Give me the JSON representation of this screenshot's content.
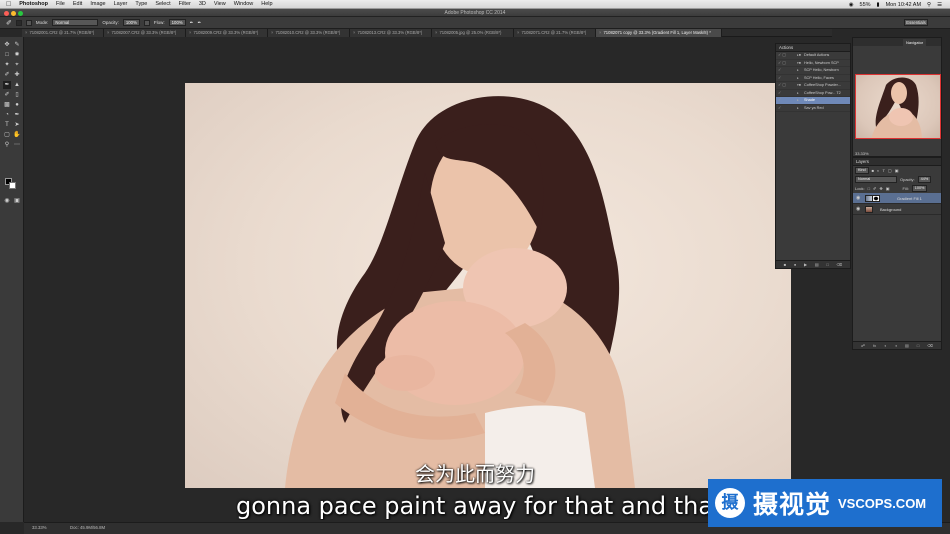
{
  "menubar": {
    "app_name": "Photoshop",
    "items": [
      "File",
      "Edit",
      "Image",
      "Layer",
      "Type",
      "Select",
      "Filter",
      "3D",
      "View",
      "Window",
      "Help"
    ],
    "battery": "55%",
    "clock": "Mon 10:42 AM"
  },
  "window": {
    "title": "Adobe Photoshop CC 2014"
  },
  "options_bar": {
    "mode_label": "Mode:",
    "mode_value": "Normal",
    "opacity_label": "Opacity:",
    "opacity_value": "100%",
    "flow_label": "Flow:",
    "flow_value": "100%",
    "workspace": "Essentials"
  },
  "tabs": [
    {
      "label": "71082001.CR2 @ 21.7% (RGB/8*)"
    },
    {
      "label": "71082007.CR2 @ 33.3% (RGB/8*)"
    },
    {
      "label": "71082009.CR2 @ 33.3% (RGB/8*)"
    },
    {
      "label": "71082010.CR2 @ 33.3% (RGB/8*)"
    },
    {
      "label": "71082013.CR2 @ 33.3% (RGB/8*)"
    },
    {
      "label": "71082005.jpg @ 25.0% (RGB/8*)"
    },
    {
      "label": "71082071.CR2 @ 21.7% (RGB/8*)"
    },
    {
      "label": "71082071 copy @ 33.3% (Gradient Fill 1, Layer Mask/8) *"
    }
  ],
  "actions_panel": {
    "title": "Actions",
    "rows": [
      {
        "label": "Default Actions",
        "selected": false
      },
      {
        "label": "Hello, Newborn SCP",
        "selected": false
      },
      {
        "label": "SCP Hello, Newborn",
        "selected": false
      },
      {
        "label": "SCP Hello, Faces",
        "selected": false
      },
      {
        "label": "CoffeeShop Powder...",
        "selected": false
      },
      {
        "label": "CoffeeShop Pow... T2",
        "selected": false
      },
      {
        "label": "Shade",
        "selected": true
      },
      {
        "label": "Sav ya Red",
        "selected": false
      }
    ]
  },
  "navigator": {
    "tabs": [
      "Navigator"
    ],
    "zoom": "33.33%"
  },
  "layers_panel": {
    "title": "Layers",
    "kind_label": "Kind",
    "blend_mode": "Normal",
    "opacity_label": "Opacity:",
    "opacity_value": "44%",
    "lock_label": "Lock:",
    "fill_label": "Fill:",
    "fill_value": "100%",
    "layers": [
      {
        "name": "Gradient Fill 1",
        "selected": true
      },
      {
        "name": "Background",
        "selected": false
      }
    ]
  },
  "status": {
    "zoom": "33.33%",
    "doc": "Doc: 45.9M/56.8M"
  },
  "subtitles": {
    "chinese": "会为此而努力",
    "english": "gonna pace paint away for that and that"
  },
  "watermark": {
    "logo_glyph": "摄",
    "chinese": "摄视觉",
    "english": "VSCOPS.COM"
  }
}
